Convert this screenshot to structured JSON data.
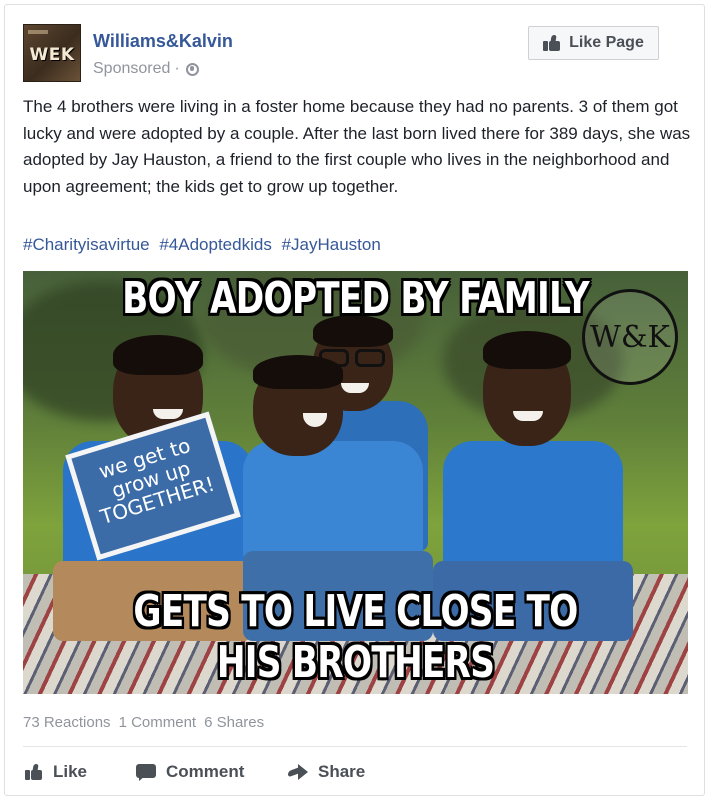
{
  "post": {
    "page_name": "Williams&Kalvin",
    "logo_text": "WEK",
    "sponsored_label": "Sponsored",
    "separator": "·",
    "like_page_label": "Like Page",
    "body_text": "The 4 brothers were living in a foster home because they had no parents. 3 of them got lucky and were adopted by a couple. After the last born lived there for 389 days, she was adopted by Jay Hauston, a friend to the first couple who lives in the neighborhood and upon agreement; the kids get to grow up together.",
    "hashtags": [
      "#Charityisavirtue",
      "#4Adoptedkids",
      "#JayHauston"
    ]
  },
  "image": {
    "top_caption": "BOY ADOPTED BY FAMILY",
    "bottom_caption": "GETS TO LIVE CLOSE TO HIS BROTHERS",
    "watermark": "W&K",
    "sign_text": "we get to grow up TOGETHER!"
  },
  "stats": {
    "reactions": "73 Reactions",
    "comments": "1 Comment",
    "shares": "6 Shares"
  },
  "actions": {
    "like": "Like",
    "comment": "Comment",
    "share": "Share"
  },
  "icons": {
    "globe": "globe-icon",
    "like": "thumbs-up-icon",
    "comment": "comment-icon",
    "share": "share-arrow-icon"
  },
  "colors": {
    "link_blue": "#365899",
    "meta_gray": "#90949c",
    "action_gray": "#4b4f56"
  }
}
